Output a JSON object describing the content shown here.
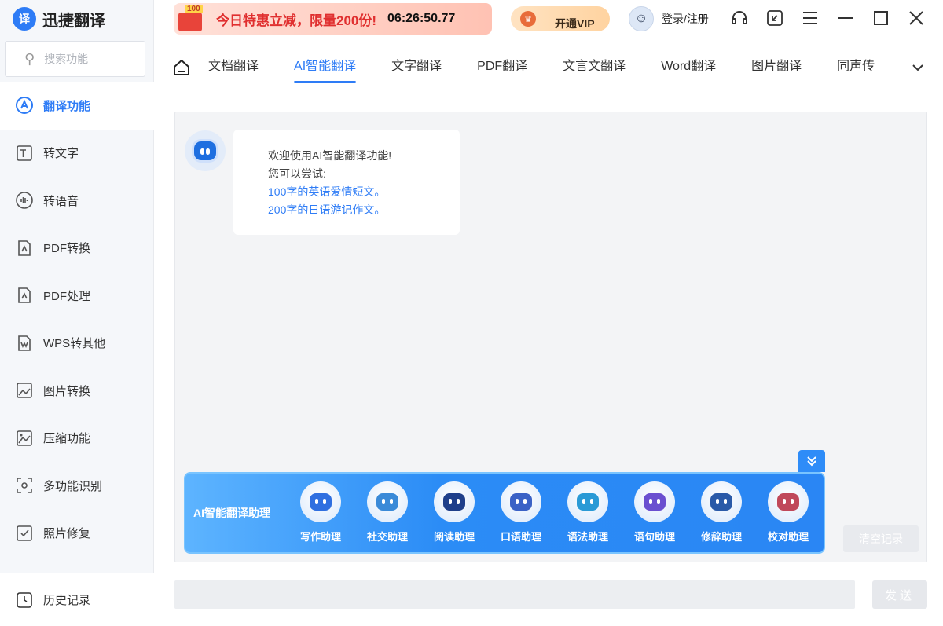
{
  "app": {
    "title": "迅捷翻译",
    "logo_char": "译"
  },
  "search": {
    "placeholder": "搜索功能"
  },
  "sidebar": {
    "items": [
      {
        "label": "翻译功能",
        "icon": "translate-icon",
        "active": true
      },
      {
        "label": "转文字",
        "icon": "text-convert-icon"
      },
      {
        "label": "转语音",
        "icon": "voice-icon"
      },
      {
        "label": "PDF转换",
        "icon": "pdf-convert-icon"
      },
      {
        "label": "PDF处理",
        "icon": "pdf-process-icon"
      },
      {
        "label": "WPS转其他",
        "icon": "wps-icon"
      },
      {
        "label": "图片转换",
        "icon": "image-convert-icon"
      },
      {
        "label": "压缩功能",
        "icon": "compress-icon"
      },
      {
        "label": "多功能识别",
        "icon": "recognize-icon"
      },
      {
        "label": "照片修复",
        "icon": "photo-repair-icon"
      }
    ],
    "history_label": "历史记录"
  },
  "promo": {
    "badge": "100",
    "text": "今日特惠立减，限量200份!",
    "timer": "06:26:50.77"
  },
  "vip": {
    "label": "开通VIP"
  },
  "user": {
    "label": "登录/注册"
  },
  "tabs": [
    {
      "label": "文档翻译"
    },
    {
      "label": "AI智能翻译",
      "active": true
    },
    {
      "label": "文字翻译"
    },
    {
      "label": "PDF翻译"
    },
    {
      "label": "文言文翻译"
    },
    {
      "label": "Word翻译"
    },
    {
      "label": "图片翻译"
    },
    {
      "label": "同声传"
    }
  ],
  "chat": {
    "welcome": "欢迎使用AI智能翻译功能!",
    "try": "您可以尝试:",
    "suggestions": [
      "100字的英语爱情短文。",
      "200字的日语游记作文。"
    ]
  },
  "assistant": {
    "title": "AI智能翻译助理",
    "helpers": [
      {
        "label": "写作助理",
        "color": "#2f6fe0"
      },
      {
        "label": "社交助理",
        "color": "#3a8ad8"
      },
      {
        "label": "阅读助理",
        "color": "#1f3f8a"
      },
      {
        "label": "口语助理",
        "color": "#3b62c6"
      },
      {
        "label": "语法助理",
        "color": "#2a9ad6"
      },
      {
        "label": "语句助理",
        "color": "#6a4fd0"
      },
      {
        "label": "修辞助理",
        "color": "#2a5aa8"
      },
      {
        "label": "校对助理",
        "color": "#c0485a"
      }
    ]
  },
  "actions": {
    "clear": "清空记录",
    "send": "发送"
  },
  "colors": {
    "accent": "#2e7cf6",
    "promo_red": "#e02f2f"
  }
}
